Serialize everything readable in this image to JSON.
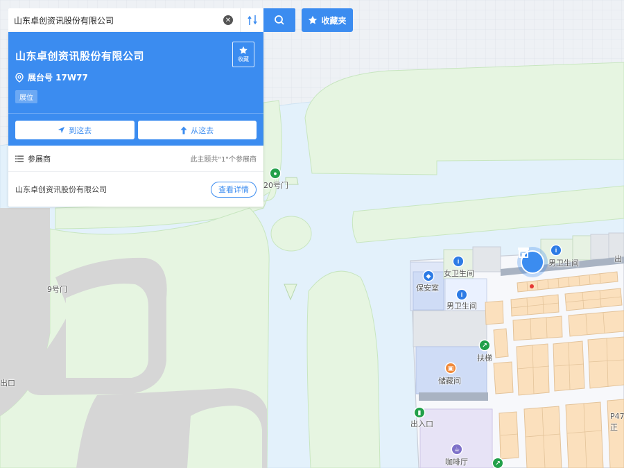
{
  "search": {
    "value": "山东卓创资讯股份有限公司",
    "placeholder": "",
    "clear_icon": "close-circle-icon",
    "route_icon": "route-icon",
    "search_icon": "search-icon"
  },
  "favorites_button": {
    "label": "收藏夹",
    "icon": "star-icon"
  },
  "panel": {
    "title": "山东卓创资讯股份有限公司",
    "booth": "展台号 17W77",
    "tag": "展位",
    "fav_label": "收藏",
    "actions": [
      {
        "label": "到这去",
        "icon": "navigate-arrow-icon"
      },
      {
        "label": "从这去",
        "icon": "up-arrow-icon"
      }
    ],
    "exhibitors_header": "参展商",
    "exhibitors_count": "此主题共\"1\"个参展商",
    "exhibitors": [
      {
        "name": "山东卓创资讯股份有限公司",
        "action": "查看详情"
      }
    ]
  },
  "map_labels": {
    "gate20": "20号门",
    "gate9": "9号门",
    "exit_left": "出口",
    "womens_restroom": "女卫生间",
    "security_room": "保安室",
    "mens_restroom_1": "男卫生间",
    "mens_restroom_2": "男卫生间",
    "escalator": "扶梯",
    "storage": "储藏间",
    "entrance_exit": "出入口",
    "cafe": "咖啡厅",
    "exit_right": "出",
    "p47": "P47",
    "zheng": "正"
  },
  "colors": {
    "accent": "#3b8cf0",
    "green_area": "#e6f5e1",
    "water": "#e3f1fb",
    "road": "#d8d8d8",
    "booth": "#fbe0bd",
    "hall_floor": "#f7f8fb",
    "grid_bg": "#eef1f5"
  }
}
